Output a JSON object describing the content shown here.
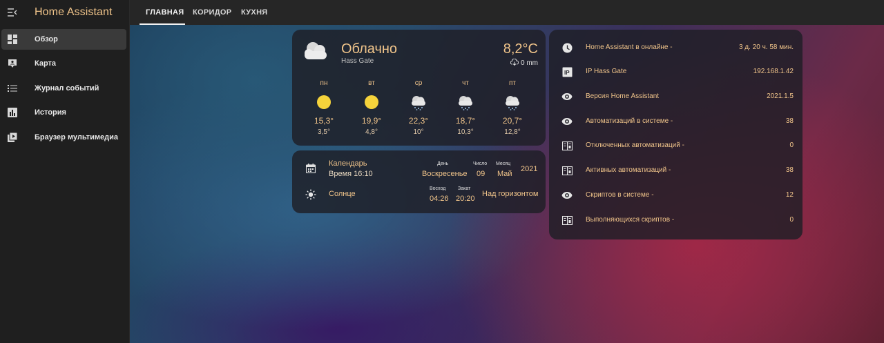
{
  "app": {
    "title": "Home Assistant"
  },
  "sidebar": {
    "items": [
      {
        "label": "Обзор",
        "icon": "dashboard-icon",
        "active": true
      },
      {
        "label": "Карта",
        "icon": "map-account-icon",
        "active": false
      },
      {
        "label": "Журнал событий",
        "icon": "logbook-icon",
        "active": false
      },
      {
        "label": "История",
        "icon": "history-chart-icon",
        "active": false
      },
      {
        "label": "Браузер мультимедиа",
        "icon": "media-player-icon",
        "active": false
      }
    ]
  },
  "tabs": [
    {
      "label": "ГЛАВНАЯ",
      "active": true
    },
    {
      "label": "КОРИДОР",
      "active": false
    },
    {
      "label": "КУХНЯ",
      "active": false
    }
  ],
  "weather": {
    "condition": "Облачно",
    "location": "Hass Gate",
    "temperature": "8,2°C",
    "precipitation": "0 mm",
    "forecast": [
      {
        "day": "пн",
        "icon": "sunny-icon",
        "high": "15,3°",
        "low": "3,5°"
      },
      {
        "day": "вт",
        "icon": "sunny-icon",
        "high": "19,9°",
        "low": "4,8°"
      },
      {
        "day": "ср",
        "icon": "snowy-cloud-icon",
        "high": "22,3°",
        "low": "10°"
      },
      {
        "day": "чт",
        "icon": "snowy-cloud-icon",
        "high": "18,7°",
        "low": "10,3°"
      },
      {
        "day": "пт",
        "icon": "snowy-cloud-icon",
        "high": "20,7°",
        "low": "12,8°"
      }
    ]
  },
  "calendar": {
    "title": "Календарь",
    "time": "Время 16:10",
    "day_label": "День",
    "day_value": "Воскресенье",
    "date_label": "Число",
    "date_value": "09",
    "month_label": "Месяц",
    "month_value": "Май",
    "year": "2021",
    "sun_title": "Солнце",
    "sunrise_label": "Восход",
    "sunrise_value": "04:26",
    "sunset_label": "Закат",
    "sunset_value": "20:20",
    "sun_state": "Над горизонтом"
  },
  "info": {
    "rows": [
      {
        "icon": "clock-icon",
        "label": "Home Assistant в онлайне -",
        "value": "3 д. 20 ч. 58 мин."
      },
      {
        "icon": "ip-icon",
        "label": "IP Hass Gate",
        "value": "192.168.1.42"
      },
      {
        "icon": "eye-icon",
        "label": "Версия Home Assistant",
        "value": "2021.1.5"
      },
      {
        "icon": "eye-icon",
        "label": "Автоматизаций в системе -",
        "value": "38"
      },
      {
        "icon": "file-document-icon",
        "label": "Отключенных автоматизаций -",
        "value": "0"
      },
      {
        "icon": "file-document-icon",
        "label": "Активных автоматизаций -",
        "value": "38"
      },
      {
        "icon": "eye-icon",
        "label": "Скриптов в системе -",
        "value": "12"
      },
      {
        "icon": "file-document-icon",
        "label": "Выполняющихся скриптов -",
        "value": "0"
      }
    ]
  },
  "colors": {
    "accent": "#f0c48a",
    "sidebar_bg": "#1f1f1f",
    "topbar_bg": "#262626",
    "card_bg": "#1e1e26"
  }
}
